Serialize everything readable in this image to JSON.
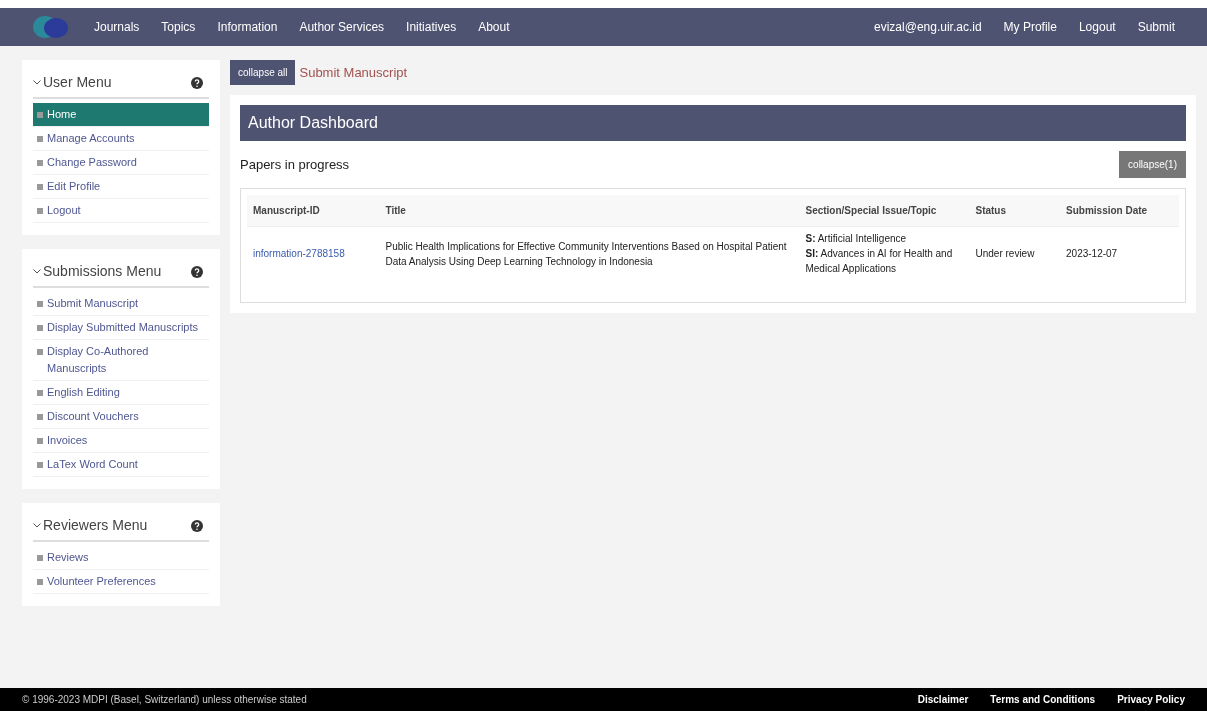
{
  "nav": {
    "left": [
      "Journals",
      "Topics",
      "Information",
      "Author Services",
      "Initiatives",
      "About"
    ],
    "right": [
      "evizal@eng.uir.ac.id",
      "My Profile",
      "Logout",
      "Submit"
    ]
  },
  "sidebar": [
    {
      "title": "User Menu",
      "items": [
        {
          "label": "Home",
          "selected": true
        },
        {
          "label": "Manage Accounts",
          "selected": false
        },
        {
          "label": "Change Password",
          "selected": false
        },
        {
          "label": "Edit Profile",
          "selected": false
        },
        {
          "label": "Logout",
          "selected": false
        }
      ]
    },
    {
      "title": "Submissions Menu",
      "items": [
        {
          "label": "Submit Manuscript",
          "selected": false
        },
        {
          "label": "Display Submitted Manuscripts",
          "selected": false
        },
        {
          "label": "Display Co-Authored Manuscripts",
          "selected": false
        },
        {
          "label": "English Editing",
          "selected": false
        },
        {
          "label": "Discount Vouchers",
          "selected": false
        },
        {
          "label": "Invoices",
          "selected": false
        },
        {
          "label": "LaTex Word Count",
          "selected": false
        }
      ]
    },
    {
      "title": "Reviewers Menu",
      "items": [
        {
          "label": "Reviews",
          "selected": false
        },
        {
          "label": "Volunteer Preferences",
          "selected": false
        }
      ]
    }
  ],
  "toolbar": {
    "collapse_all": "collapse all",
    "submit_link": "Submit Manuscript"
  },
  "dashboard": {
    "title": "Author Dashboard",
    "section": "Papers in progress",
    "collapse": "collapse(1)",
    "table": {
      "columns": [
        "Manuscript-ID",
        "Title",
        "Section/Special Issue/Topic",
        "Status",
        "Submission Date"
      ],
      "rows": [
        {
          "id": "information-2788158",
          "title": "Public Health Implications for Effective Community Interventions Based on Hospital Patient Data Analysis Using Deep Learning Technology in Indonesia",
          "section": [
            "**S:** Artificial Intelligence",
            "**SI:** Advances in AI for Health and Medical Applications"
          ],
          "status": "Under review",
          "date": "2023-12-07"
        }
      ]
    }
  },
  "footer": {
    "copyright": "© 1996-2023 MDPI (Basel, Switzerland) unless otherwise stated",
    "links": [
      "Disclaimer",
      "Terms and Conditions",
      "Privacy Policy"
    ]
  }
}
